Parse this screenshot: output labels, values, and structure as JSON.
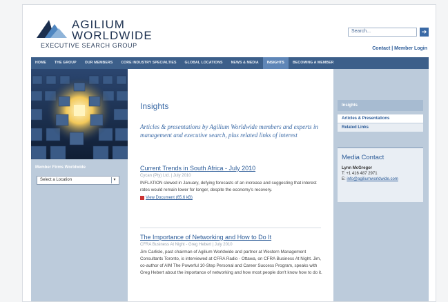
{
  "logo": {
    "line1": "AGILIUM",
    "line2": "WORLDWIDE",
    "line3": "EXECUTIVE SEARCH GROUP"
  },
  "search": {
    "placeholder": "Search...",
    "button_icon": "arrow-right-icon"
  },
  "util_links": {
    "contact": "Contact",
    "separator": "|",
    "member_login": "Member Login"
  },
  "nav": {
    "items": [
      "HOME",
      "THE GROUP",
      "OUR MEMBERS",
      "CORE INDUSTRY SPECIALTIES",
      "GLOBAL LOCATIONS",
      "NEWS & MEDIA",
      "INSIGHTS",
      "BECOMING A MEMBER"
    ],
    "active": "INSIGHTS"
  },
  "left": {
    "member_title": "Member Firms Worldwide",
    "location_select": "Select a Location"
  },
  "main": {
    "title": "Insights",
    "intro": "Articles & presentations by Agilium Worldwide members and experts in management and executive search, plus related links of interest",
    "articles": [
      {
        "title": "Current Trends in South Africa - July 2010",
        "meta": "Cycan (Pty) Ltd. | July 2010",
        "body": "INFLATION slowed in January, defying forecasts of an increase and suggesting that interest rates would remain lower for longer, despite the economy's recovery.",
        "link": "View Document (65.6 kB)"
      },
      {
        "title": "The Importance of Networking and How to Do It",
        "meta": "CFRA Business At Night - Greg Hebert | July 2010",
        "body": "Jim Carlisle, past chairman of Agilium Worldwide and partner at Western Management Consultants Toronto, is interviewed at CFRA Radio - Ottawa, on CFRA Business At Night. Jim, co-author of AIM The Powerful 10-Step Personal and Career Success Program, speaks with Greg Hebert about the importance of networking and how most people don't know how to do it."
      }
    ]
  },
  "sidebar": {
    "heading": "Insights",
    "items": [
      "Articles & Presentations",
      "Related Links"
    ],
    "contact": {
      "title": "Media Contact",
      "name": "Lynn McGregor",
      "phone": "T: +1 416 487 2971",
      "email_label": "E:",
      "email": "info@agiliumworldwide.com"
    }
  },
  "colors": {
    "nav_bg": "#3c5f8a",
    "nav_active": "#5f86b7",
    "accent": "#3b6aa6",
    "sidebar_bg": "#bccbdb"
  }
}
